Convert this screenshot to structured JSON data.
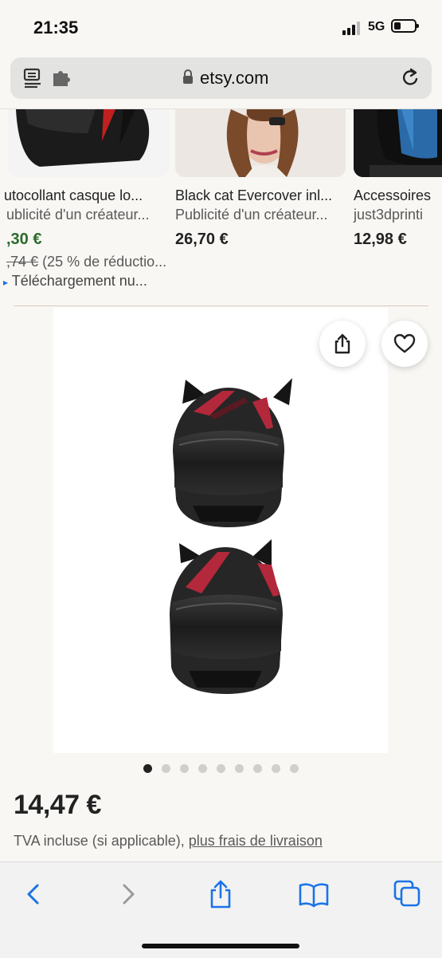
{
  "status": {
    "time": "21:35",
    "network": "5G"
  },
  "browser": {
    "domain": "etsy.com"
  },
  "carousel": [
    {
      "title": "utocollant casque lo...",
      "subtitle": "ublicité d'un créateur...",
      "price": ",30 €",
      "original_price": ",74 €",
      "discount": "(25 % de réductio...",
      "download": "Téléchargement nu..."
    },
    {
      "title": "Black cat Evercover inl...",
      "subtitle": "Publicité d'un créateur...",
      "price": "26,70 €"
    },
    {
      "title": "Accessoires",
      "subtitle": "just3dprinti",
      "price": "12,98 €"
    }
  ],
  "product": {
    "price": "14,47 €",
    "tax_text": "TVA incluse (si applicable), ",
    "shipping_link": "plus frais de livraison"
  },
  "gallery": {
    "dot_count": 9,
    "active_index": 0
  },
  "colors": {
    "sale_green": "#2a6a2a",
    "accent_blue": "#1a73e8",
    "background": "#f8f7f4"
  },
  "icons": [
    "reader-icon",
    "extension-icon",
    "lock-icon",
    "reload-icon",
    "share-icon",
    "heart-icon",
    "back-icon",
    "forward-icon",
    "bookmarks-icon",
    "tabs-icon"
  ]
}
